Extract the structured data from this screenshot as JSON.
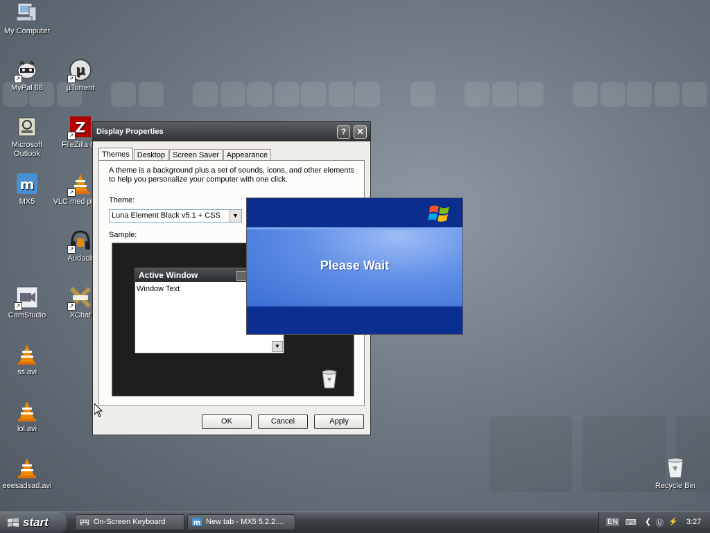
{
  "desktop": {
    "icons": [
      {
        "label": "My Computer"
      },
      {
        "label": "MyPal 68"
      },
      {
        "label": "µTorrent"
      },
      {
        "label": "Microsoft Outlook"
      },
      {
        "label": "FileZilla Cli"
      },
      {
        "label": "MX5"
      },
      {
        "label": "VLC med player"
      },
      {
        "label": "Audacit"
      },
      {
        "label": "CamStudio"
      },
      {
        "label": "XChat"
      },
      {
        "label": "ss.avi"
      },
      {
        "label": "lol.avi"
      },
      {
        "label": "eeesadsad.avi"
      },
      {
        "label": "Recycle Bin"
      }
    ]
  },
  "dialog": {
    "title": "Display Properties",
    "help_glyph": "?",
    "close_glyph": "✕",
    "tabs": [
      {
        "label": "Themes"
      },
      {
        "label": "Desktop"
      },
      {
        "label": "Screen Saver"
      },
      {
        "label": "Appearance"
      }
    ],
    "description": "A theme is a background plus a set of sounds, icons, and other elements to help you personalize your computer with one click.",
    "theme_label": "Theme:",
    "theme_value": "Luna Element Black v5.1 + CSS",
    "sample_label": "Sample:",
    "sample_window_title": "Active Window",
    "sample_window_text": "Window Text",
    "buttons": {
      "ok": "OK",
      "cancel": "Cancel",
      "apply": "Apply"
    }
  },
  "splash": {
    "message": "Please Wait"
  },
  "taskbar": {
    "start_label": "start",
    "tasks": [
      {
        "label": "On-Screen Keyboard"
      },
      {
        "label": "New tab - MX5 5.2.2...."
      }
    ],
    "tray": {
      "language": "EN",
      "clock": "3:27"
    }
  },
  "colors": {
    "splash_blue": "#0a2f91",
    "dialog_title": "#2f3235",
    "taskbar": "#3b4146"
  }
}
